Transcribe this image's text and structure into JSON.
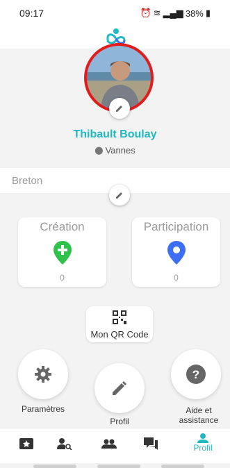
{
  "status_bar": {
    "time": "09:17",
    "battery": "38%"
  },
  "profile": {
    "name": "Thibault Boulay",
    "city": "Vannes",
    "language": "Breton"
  },
  "cards": {
    "creation": {
      "title": "Création",
      "count": "0"
    },
    "participation": {
      "title": "Participation",
      "count": "0"
    }
  },
  "qr": {
    "label": "Mon QR Code"
  },
  "actions": {
    "settings": "Paramètres",
    "profile": "Profil",
    "help": "Aide et assistance"
  },
  "bottom_nav": {
    "active_label": "Profil"
  },
  "colors": {
    "accent": "#21b8c0",
    "avatar_ring": "#e21c1c",
    "creation": "#2ec24a",
    "participation": "#3d6ef5"
  }
}
